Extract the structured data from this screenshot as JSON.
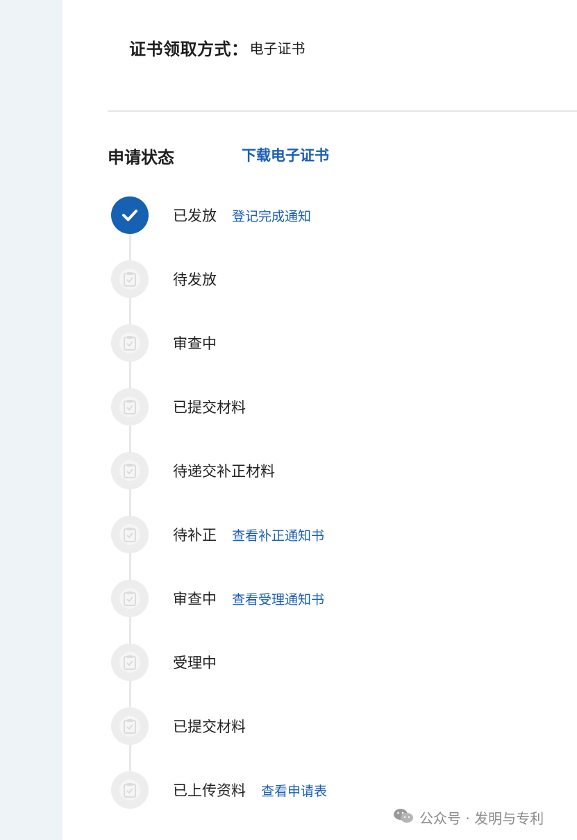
{
  "certificate": {
    "label": "证书领取方式：",
    "value": "电子证书"
  },
  "status_section": {
    "title": "申请状态",
    "download_link": "下载电子证书"
  },
  "steps": [
    {
      "label": "已发放",
      "link": "登记完成通知",
      "state": "done"
    },
    {
      "label": "待发放",
      "link": "",
      "state": "pending"
    },
    {
      "label": "审查中",
      "link": "",
      "state": "pending"
    },
    {
      "label": "已提交材料",
      "link": "",
      "state": "pending"
    },
    {
      "label": "待递交补正材料",
      "link": "",
      "state": "pending"
    },
    {
      "label": "待补正",
      "link": "查看补正通知书",
      "state": "pending"
    },
    {
      "label": "审查中",
      "link": "查看受理通知书",
      "state": "pending"
    },
    {
      "label": "受理中",
      "link": "",
      "state": "pending"
    },
    {
      "label": "已提交材料",
      "link": "",
      "state": "pending"
    },
    {
      "label": "已上传资料",
      "link": "查看申请表",
      "state": "pending"
    }
  ],
  "watermark": {
    "text": "公众号 · 发明与专利",
    "icon": "wechat-icon"
  },
  "colors": {
    "accent": "#1761b2",
    "link": "#1a5fb4",
    "pending_circle": "#ededed",
    "side_strip": "#eef3f8"
  }
}
